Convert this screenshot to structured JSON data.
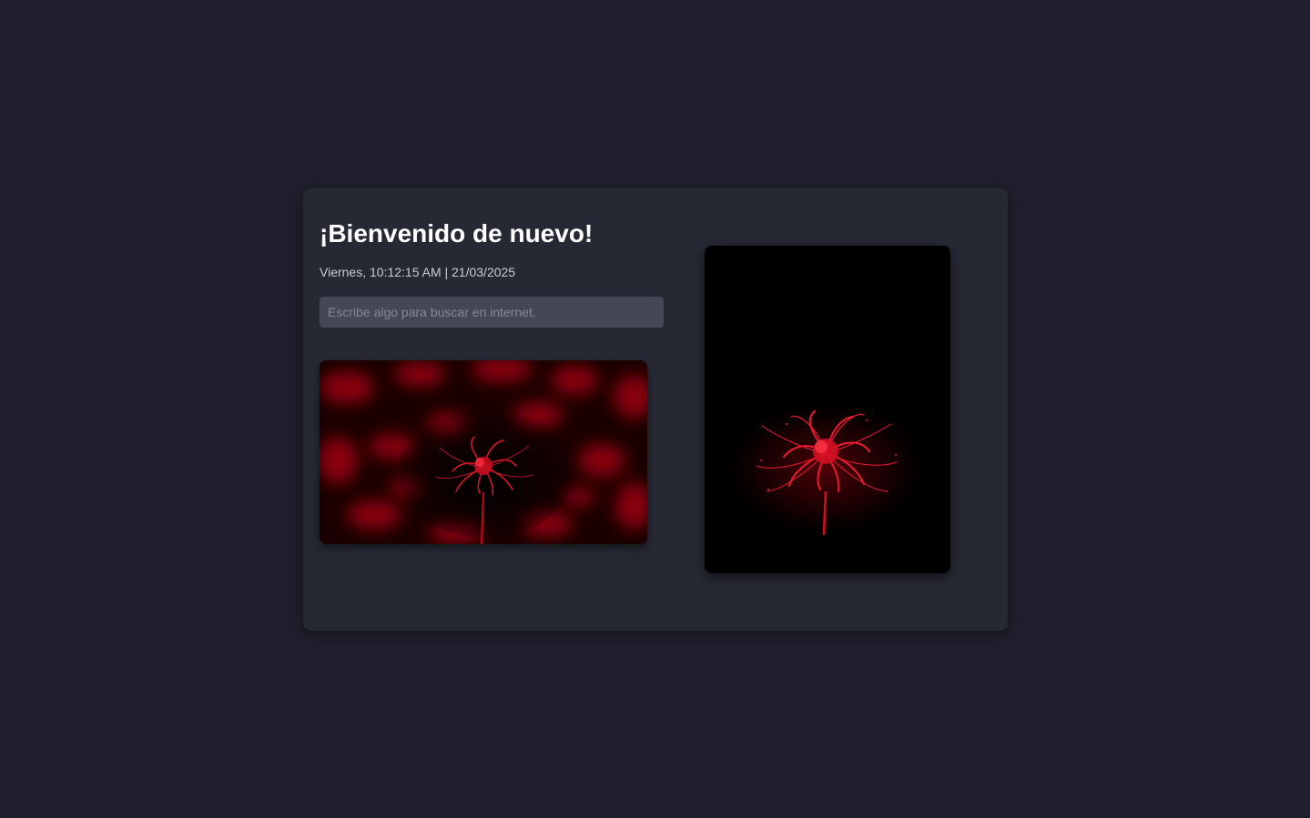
{
  "welcome": {
    "title": "¡Bienvenido de nuevo!",
    "datetime": "Viernes, 10:12:15 AM | 21/03/2025"
  },
  "search": {
    "placeholder": "Escribe algo para buscar en internet.",
    "value": ""
  },
  "images": {
    "left": {
      "subject": "red spider lily on blurred red bokeh background",
      "icon": "flower-photo"
    },
    "right": {
      "subject": "red spider lily on black background",
      "icon": "flower-photo"
    }
  },
  "colors": {
    "page_background": "#1f1f2d",
    "card_background": "#262833",
    "input_background": "#454757",
    "flower_red": "#e0142a"
  }
}
